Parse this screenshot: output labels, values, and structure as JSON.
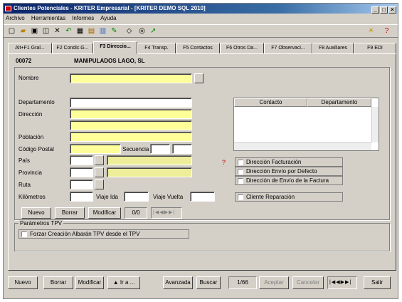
{
  "window": {
    "title": "Clientes Potenciales - KRITER Empresarial - [KRITER DEMO SQL 2010]",
    "controls": [
      "_",
      "□",
      "×"
    ]
  },
  "menu": [
    "Archivo",
    "Herramientas",
    "Informes",
    "Ayuda"
  ],
  "tabs": [
    "Alt+F1 Gral...",
    "F2 Condic.G...",
    "F3 Direccio...",
    "F4 Transp.",
    "F5 Contactos",
    "F6 Otros Da...",
    "F7 Observaci...",
    "F8 Auxiliares",
    "F9 EDI"
  ],
  "active_tab": "F3 Direccio...",
  "record": {
    "code": "00072",
    "name": "MANIPULADOS LAGO, SL"
  },
  "form": {
    "nombre": "Nombre",
    "departamento": "Departamento",
    "direccion": "Dirección",
    "poblacion": "Población",
    "codigo_postal": "Código Postal",
    "secuencia": "Secuencia",
    "pais": "País",
    "provincia": "Provincia",
    "ruta": "Ruta",
    "kilometros": "Kilómetros",
    "viaje_ida": "Viaje Ida",
    "viaje_vuelta": "Viaje Vuelta"
  },
  "grid": {
    "headers": [
      "Contacto",
      "Departamento"
    ]
  },
  "checks": {
    "facturacion": "Dirección Facturación",
    "envio_defecto": "Dirección Envío por Defecto",
    "envio_factura": "Dirección de Envío de la Factura",
    "reparacion": "Cliente Reparación"
  },
  "sub_buttons": {
    "nuevo": "Nuevo",
    "borrar": "Borrar",
    "modificar": "Modificar",
    "counter": "0/0",
    "nav": "|◀◀▶▶|"
  },
  "tpv": {
    "group": "Parámetros TPV",
    "forzar": "Forzar Creación Albarán TPV desde el TPV"
  },
  "bottom": {
    "nuevo": "Nuevo",
    "borrar": "Borrar",
    "modificar": "Modificar",
    "ira": "▲ Ir a ...",
    "avanzada": "Avanzada",
    "buscar": "Buscar",
    "counter": "1/66",
    "aceptar": "Aceptar",
    "cancelar": "Cancelar",
    "nav": "|◀◀▶▶|",
    "salir": "Salir"
  }
}
